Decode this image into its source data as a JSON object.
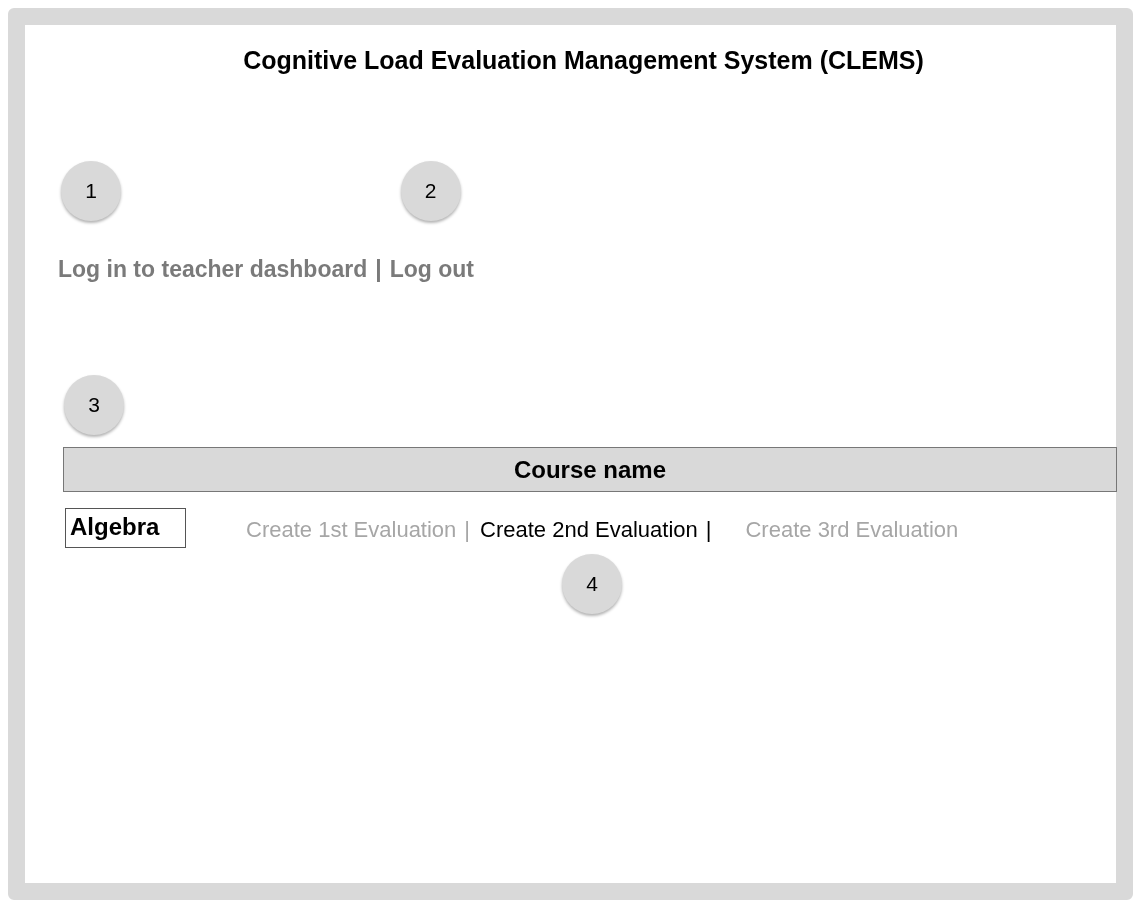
{
  "title": "Cognitive Load Evaluation Management System (CLEMS)",
  "session_links": [
    {
      "label": "Log in to teacher dashboard",
      "separator": "|",
      "marker": "1"
    },
    {
      "label": "Log out",
      "marker": "2"
    }
  ],
  "table": {
    "marker": "3",
    "header": "Course name",
    "rows": [
      {
        "course": "Algebra",
        "evaluations": [
          {
            "label": "Create 1st Evaluation",
            "separator": "|",
            "disabled": true
          },
          {
            "label": "Create 2nd Evaluation",
            "separator": "|",
            "disabled": false,
            "marker": "4"
          },
          {
            "label": "Create 3rd Evaluation",
            "disabled": true
          }
        ]
      }
    ]
  }
}
